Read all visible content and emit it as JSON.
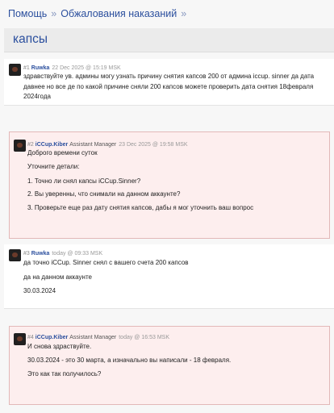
{
  "breadcrumb": {
    "home": "Помощь",
    "sep1": "»",
    "section": "Обжалования наказаний",
    "sep2": "»"
  },
  "page": {
    "title": "капсы"
  },
  "posts": [
    {
      "number": "#1",
      "user": "Ruwka",
      "date": "22 Dec 2025 @ 15:19 MSK",
      "body": "здравствуйте ув. админы могу узнать причину снятия капсов 200 от админа iccup. sinner да дата давнее но все де по какой причине сняли 200 капсов можете проверить дата снятия 18февраля 2024года"
    },
    {
      "number": "#2",
      "user": "iCCup.Kiber",
      "role": "Assistant Manager",
      "date": "23 Dec 2025 @ 19:58 MSK",
      "greeting": "Доброго времени суток",
      "lines": [
        "Уточните детали:",
        "1. Точно ли снял капсы iCCup.Sinner?",
        "2. Вы уверенны, что снимали на данном аккаунте?",
        "3. Проверьте еще раз дату снятия капсов, дабы я мог уточнить ваш вопрос"
      ]
    },
    {
      "number": "#3",
      "user": "Ruwka",
      "date": "today @ 09:33 MSK",
      "lines": [
        "да точно iCCup. Sinner снял с вашего счета 200 капсов",
        "да на данном аккаунте",
        "30.03.2024"
      ]
    },
    {
      "number": "#4",
      "user": "iCCup.Kiber",
      "role": "Assistant Manager",
      "date": "today @ 16:53 MSK",
      "greeting": "И снова здраствуйте.",
      "lines": [
        "30.03.2024 - это 30 марта, а изначально вы написали - 18 февраля.",
        "Это как так получилось?"
      ]
    }
  ]
}
